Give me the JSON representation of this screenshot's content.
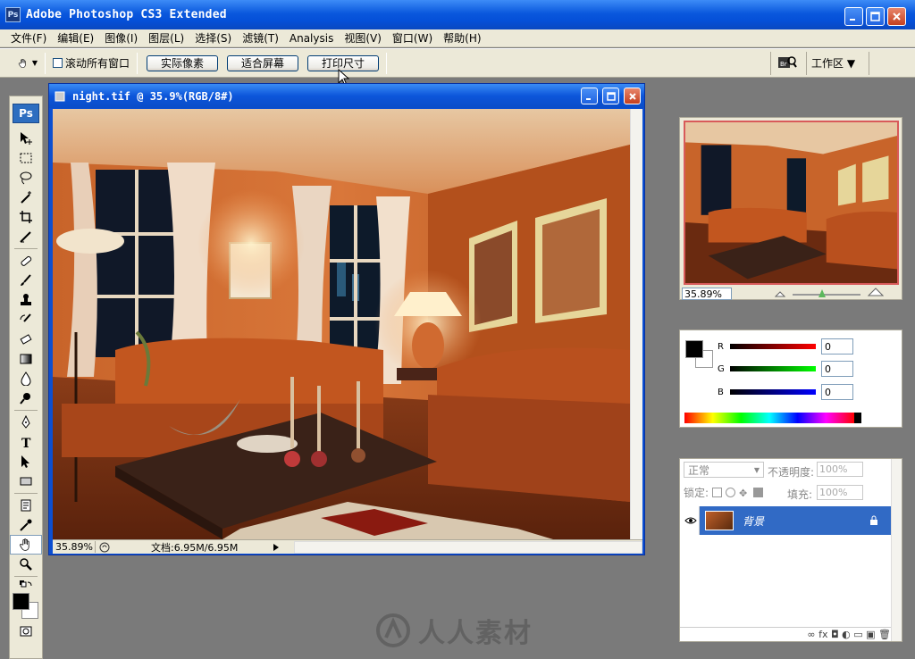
{
  "app": {
    "title": "Adobe Photoshop CS3 Extended",
    "logo_text": "Ps"
  },
  "menu": [
    "文件(F)",
    "编辑(E)",
    "图像(I)",
    "图层(L)",
    "选择(S)",
    "滤镜(T)",
    "Analysis",
    "视图(V)",
    "窗口(W)",
    "帮助(H)"
  ],
  "options": {
    "scroll_all_label": "滚动所有窗口",
    "actual_pixels": "实际像素",
    "fit_screen": "适合屏幕",
    "print_size": "打印尺寸",
    "workspace": "工作区 ▼"
  },
  "toolbox": {
    "badge": "Ps"
  },
  "document": {
    "title": "night.tif @ 35.9%(RGB/8#)",
    "zoom": "35.89%",
    "doc_size": "文档:6.95M/6.95M"
  },
  "navigator": {
    "zoom": "35.89%"
  },
  "color_panel": {
    "channels": [
      {
        "label": "R",
        "value": "0",
        "gradient": "#000000,#ff0000"
      },
      {
        "label": "G",
        "value": "0",
        "gradient": "#000000,#00ff00"
      },
      {
        "label": "B",
        "value": "0",
        "gradient": "#000000,#0000ff"
      }
    ]
  },
  "layers_panel": {
    "blend_mode": "正常",
    "opacity_label": "不透明度:",
    "opacity_value": "100%",
    "lock_label": "锁定:",
    "fill_label": "填充:",
    "fill_value": "100%",
    "layer_name": "背景",
    "footer_icons": "∞  fx  ◘  ◐  ▭  ▣  🗑"
  },
  "watermark": {
    "text": "人人素材"
  },
  "colors": {
    "titlebar": "#0a58dd",
    "panel_bg": "#ece9d8",
    "workspace_bg": "#7a7a7a",
    "layer_selected": "#316ac5"
  }
}
